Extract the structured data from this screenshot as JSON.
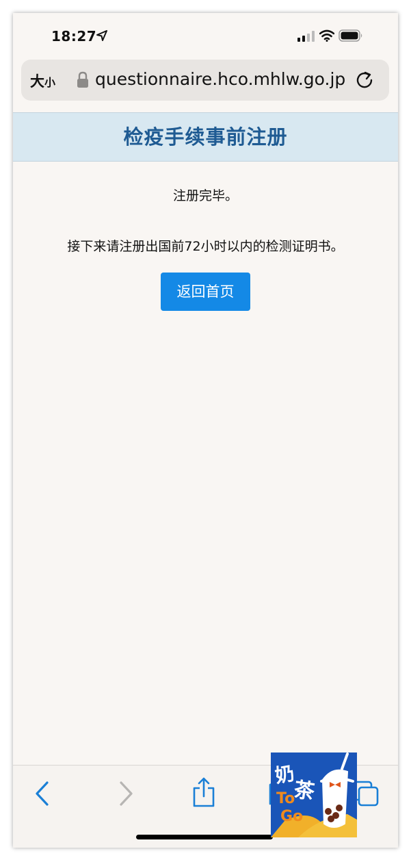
{
  "status_bar": {
    "time": "18:27"
  },
  "browser": {
    "text_size_label": "大",
    "text_size_small": "小",
    "url": "questionnaire.hco.mhlw.go.jp"
  },
  "page": {
    "title": "检疫手续事前注册",
    "message_complete": "注册完毕。",
    "message_next": "接下来请注册出国前72小时以内的检测证明书。",
    "home_button_label": "返回首页"
  },
  "watermark": {
    "text_cn": "奶茶",
    "text_en_1": "To",
    "text_en_2": "Go"
  },
  "colors": {
    "header_bg": "#d8e8f1",
    "title_text": "#1f5b93",
    "button_bg": "#1489e6",
    "toolbar_icon": "#1a7fd6",
    "page_bg": "#f9f6f3"
  }
}
